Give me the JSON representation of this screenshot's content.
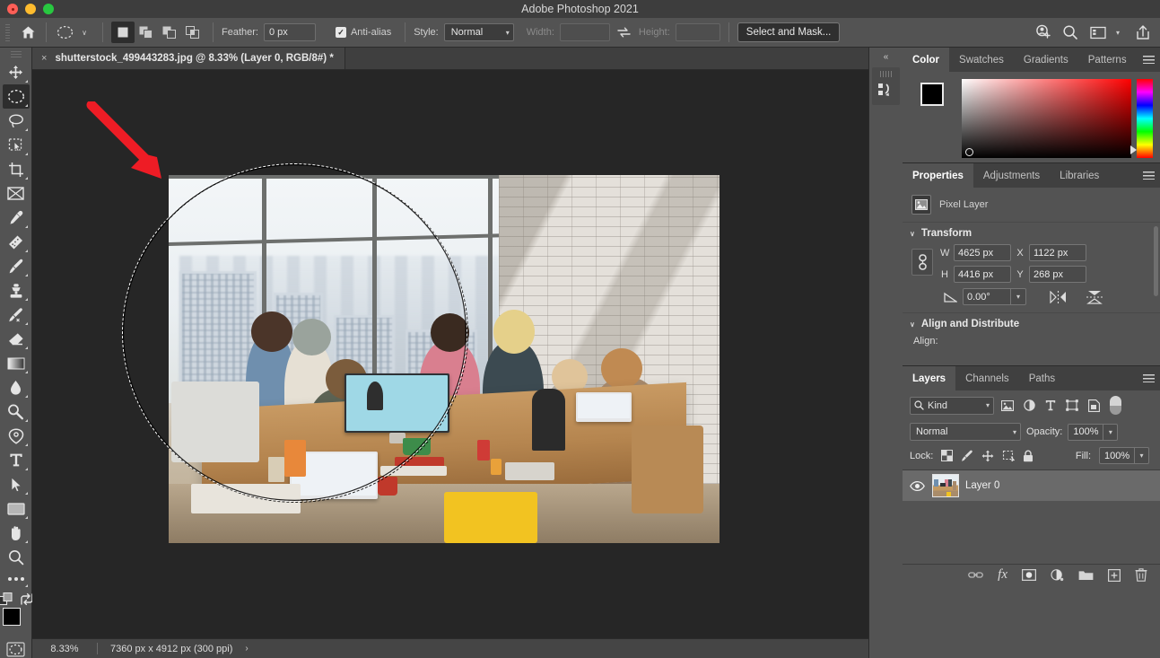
{
  "window": {
    "title": "Adobe Photoshop 2021",
    "traffic_lights": [
      "close-button",
      "minimize-button",
      "maximize-button"
    ]
  },
  "options_bar": {
    "home_icon": "home-icon",
    "tool_preset": "elliptical-marquee-icon",
    "tool_preset_chevron": "∨",
    "selection_modes": [
      {
        "name": "new-selection",
        "active": true
      },
      {
        "name": "add-to-selection",
        "active": false
      },
      {
        "name": "subtract-from-selection",
        "active": false
      },
      {
        "name": "intersect-selection",
        "active": false
      }
    ],
    "feather_label": "Feather:",
    "feather_value": "0 px",
    "antialias_label": "Anti-alias",
    "antialias_checked": true,
    "antialias_check_glyph": "✓",
    "style_label": "Style:",
    "style_value": "Normal",
    "width_label": "Width:",
    "width_value": "",
    "swap_icon": "swap-width-height-icon",
    "height_label": "Height:",
    "height_value": "",
    "select_and_mask_label": "Select and Mask...",
    "right_icons": [
      "add-person-icon",
      "search-icon",
      "workspace-icon",
      "workspace-chevron-icon",
      "share-icon"
    ]
  },
  "toolbar": {
    "tools": [
      {
        "name": "move-tool",
        "active": false,
        "has_flyout": true
      },
      {
        "name": "elliptical-marquee-tool",
        "active": true,
        "has_flyout": true
      },
      {
        "name": "lasso-tool",
        "active": false,
        "has_flyout": true
      },
      {
        "name": "object-selection-tool",
        "active": false,
        "has_flyout": true
      },
      {
        "name": "crop-tool",
        "active": false,
        "has_flyout": true
      },
      {
        "name": "frame-tool",
        "active": false,
        "has_flyout": false
      },
      {
        "name": "eyedropper-tool",
        "active": false,
        "has_flyout": true
      },
      {
        "name": "spot-healing-brush-tool",
        "active": false,
        "has_flyout": true
      },
      {
        "name": "brush-tool",
        "active": false,
        "has_flyout": true
      },
      {
        "name": "clone-stamp-tool",
        "active": false,
        "has_flyout": true
      },
      {
        "name": "history-brush-tool",
        "active": false,
        "has_flyout": true
      },
      {
        "name": "eraser-tool",
        "active": false,
        "has_flyout": true
      },
      {
        "name": "gradient-tool",
        "active": false,
        "has_flyout": true
      },
      {
        "name": "blur-tool",
        "active": false,
        "has_flyout": true
      },
      {
        "name": "dodge-tool",
        "active": false,
        "has_flyout": true
      },
      {
        "name": "pen-tool",
        "active": false,
        "has_flyout": true
      },
      {
        "name": "type-tool",
        "active": false,
        "has_flyout": true
      },
      {
        "name": "path-selection-tool",
        "active": false,
        "has_flyout": true
      },
      {
        "name": "rectangle-tool",
        "active": false,
        "has_flyout": true
      },
      {
        "name": "hand-tool",
        "active": false,
        "has_flyout": true
      },
      {
        "name": "zoom-tool",
        "active": false,
        "has_flyout": false
      },
      {
        "name": "edit-toolbar-tool",
        "active": false,
        "has_flyout": true
      }
    ],
    "screen_mode_icon": "screen-mode-icon",
    "swap_colors_icon": "swap-colors-icon",
    "foreground_color": "#000000",
    "background_color": "#ffffff",
    "quick_mask_icon": "quick-mask-icon"
  },
  "document": {
    "tab_title": "shutterstock_499443283.jpg @ 8.33% (Layer 0, RGB/8#) *",
    "tab_close_glyph": "×",
    "selection": {
      "type": "ellipse",
      "tool": "elliptical-marquee"
    },
    "annotation": {
      "type": "red-arrow",
      "color": "#ee1c25"
    }
  },
  "status_bar": {
    "zoom": "8.33%",
    "doc_size": "7360 px x 4912 px (300 ppi)",
    "chevron": "›"
  },
  "rail": {
    "collapse_glyph": "«",
    "icons": [
      "history-actions-icon"
    ]
  },
  "color_panel": {
    "tabs": [
      {
        "label": "Color",
        "active": true
      },
      {
        "label": "Swatches",
        "active": false
      },
      {
        "label": "Gradients",
        "active": false
      },
      {
        "label": "Patterns",
        "active": false
      }
    ],
    "menu_icon": "panel-menu-icon",
    "foreground": "#000000",
    "background": "#ffffff",
    "selected_hue": "#ff0000"
  },
  "properties_panel": {
    "tabs": [
      {
        "label": "Properties",
        "active": true
      },
      {
        "label": "Adjustments",
        "active": false
      },
      {
        "label": "Libraries",
        "active": false
      }
    ],
    "menu_icon": "panel-menu-icon",
    "layer_kind_icon": "pixel-layer-icon",
    "layer_kind": "Pixel Layer",
    "transform": {
      "title": "Transform",
      "collapse_glyph": "∨",
      "link_icon": "link-width-height-icon",
      "w_label": "W",
      "w_value": "4625 px",
      "x_label": "X",
      "x_value": "1122 px",
      "h_label": "H",
      "h_value": "4416 px",
      "y_label": "Y",
      "y_value": "268 px",
      "angle_icon": "angle-icon",
      "angle_value": "0.00°",
      "angle_chevron": "∨",
      "flip_horizontal_icon": "flip-horizontal-icon",
      "flip_vertical_icon": "flip-vertical-icon"
    },
    "align": {
      "title": "Align and Distribute",
      "collapse_glyph": "∨",
      "align_label": "Align:"
    }
  },
  "layers_panel": {
    "tabs": [
      {
        "label": "Layers",
        "active": true
      },
      {
        "label": "Channels",
        "active": false
      },
      {
        "label": "Paths",
        "active": false
      }
    ],
    "menu_icon": "panel-menu-icon",
    "filter": {
      "search_icon": "search-icon",
      "kind_label": "Kind",
      "chevron": "∨",
      "icons": [
        "filter-pixel-icon",
        "filter-adjustment-icon",
        "filter-type-icon",
        "filter-shape-icon",
        "filter-smart-object-icon"
      ],
      "toggle_icon": "filter-toggle-switch"
    },
    "blend_mode": "Normal",
    "blend_chevron": "∨",
    "opacity_label": "Opacity:",
    "opacity_value": "100%",
    "lock_label": "Lock:",
    "lock_icons": [
      "lock-transparent-pixels-icon",
      "lock-image-pixels-icon",
      "lock-position-icon",
      "lock-artboard-nesting-icon",
      "lock-all-icon"
    ],
    "fill_label": "Fill:",
    "fill_value": "100%",
    "stepper_chevron": "∨",
    "layers": [
      {
        "name": "Layer 0",
        "visible": true,
        "visibility_icon": "eye-icon",
        "selected": true
      }
    ],
    "footer_icons": [
      "link-layers-icon",
      "layer-style-fx-icon",
      "add-layer-mask-icon",
      "new-adjustment-layer-icon",
      "new-group-icon",
      "new-layer-icon",
      "delete-layer-icon"
    ],
    "fx_label": "fx"
  }
}
